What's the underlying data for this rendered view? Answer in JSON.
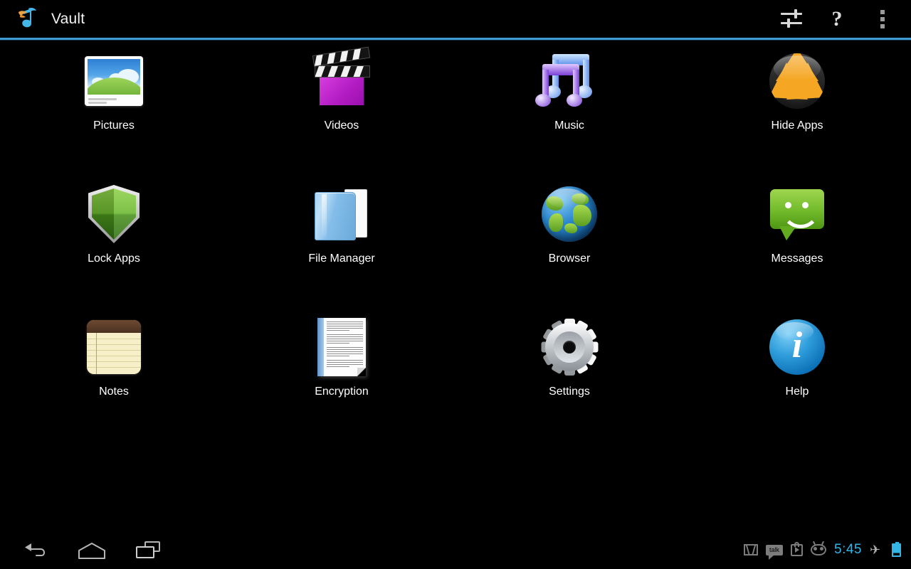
{
  "app": {
    "title": "Vault",
    "logo_icon": "music-note-logo-icon",
    "accent_color": "#3d9cd4",
    "background_color": "#000000"
  },
  "action_bar": {
    "buttons": [
      {
        "name": "settings-sliders-button",
        "icon": "sliders-icon",
        "label": ""
      },
      {
        "name": "help-button",
        "icon": "question-mark-icon",
        "label": "?"
      },
      {
        "name": "overflow-menu-button",
        "icon": "overflow-dots-icon",
        "label": ""
      }
    ]
  },
  "grid": {
    "apps": [
      {
        "label": "Pictures",
        "icon": "pictures-icon"
      },
      {
        "label": "Videos",
        "icon": "videos-clapperboard-icon"
      },
      {
        "label": "Music",
        "icon": "music-notes-icon"
      },
      {
        "label": "Hide Apps",
        "icon": "hide-apps-burn-icon"
      },
      {
        "label": "Lock Apps",
        "icon": "lock-apps-shield-icon"
      },
      {
        "label": "File Manager",
        "icon": "file-manager-folder-icon"
      },
      {
        "label": "Browser",
        "icon": "browser-globe-icon"
      },
      {
        "label": "Messages",
        "icon": "messages-bubble-icon"
      },
      {
        "label": "Notes",
        "icon": "notes-notepad-icon"
      },
      {
        "label": "Encryption",
        "icon": "encryption-document-icon"
      },
      {
        "label": "Settings",
        "icon": "settings-gear-icon"
      },
      {
        "label": "Help",
        "icon": "help-info-icon"
      }
    ]
  },
  "system_bar": {
    "nav": [
      {
        "name": "back-button",
        "icon": "back-arrow-icon"
      },
      {
        "name": "home-button",
        "icon": "home-icon"
      },
      {
        "name": "recent-apps-button",
        "icon": "recent-apps-icon"
      }
    ],
    "status": {
      "notifications": [
        {
          "name": "gmail-notification-icon",
          "icon": "gmail-icon",
          "label": "M"
        },
        {
          "name": "talk-notification-icon",
          "icon": "talk-icon",
          "label": "talk"
        },
        {
          "name": "play-store-notification-icon",
          "icon": "play-store-icon",
          "label": ""
        },
        {
          "name": "cyanogenmod-notification-icon",
          "icon": "cyanogenmod-icon",
          "label": ""
        }
      ],
      "time": "5:45",
      "time_color": "#33b5e5",
      "airplane_mode_icon": "airplane-mode-icon",
      "airplane_glyph": "✈",
      "battery_icon": "battery-icon"
    }
  }
}
